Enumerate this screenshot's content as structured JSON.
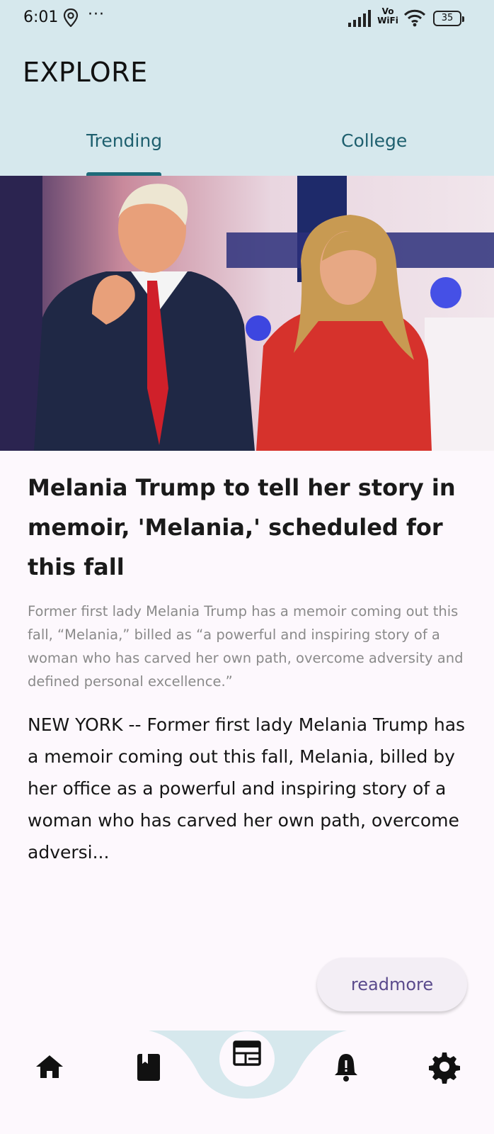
{
  "status_bar": {
    "time": "6:01",
    "more": "···",
    "vowifi_top": "Vo",
    "vowifi_bottom": "WiFi",
    "battery": "35"
  },
  "header": {
    "title": "EXPLORE",
    "tabs": [
      {
        "label": "Trending",
        "selected": true
      },
      {
        "label": "College",
        "selected": false
      }
    ]
  },
  "article": {
    "headline": "Melania Trump to tell her story in memoir, 'Melania,' scheduled for this fall",
    "summary": "Former first lady Melania Trump has a memoir coming out this fall, “Melania,” billed as “a powerful and inspiring story of a woman who has carved her own path, overcome adversity and defined personal excellence.”",
    "body": "NEW YORK -- Former first lady Melania Trump has a memoir coming out this fall, Melania, billed by her office as a powerful and inspiring story of a woman who has carved her own path, overcome adversi...",
    "readmore_label": "readmore"
  },
  "bottom_nav": {
    "items": [
      {
        "icon": "home-icon"
      },
      {
        "icon": "book-icon"
      },
      {
        "icon": "newspaper-icon",
        "active": true
      },
      {
        "icon": "bell-icon"
      },
      {
        "icon": "gear-icon"
      }
    ]
  },
  "colors": {
    "header_bg": "#d6e8ed",
    "accent": "#1e6b7a",
    "page_bg": "#fdf8fd",
    "readmore_text": "#5a4a8c"
  }
}
